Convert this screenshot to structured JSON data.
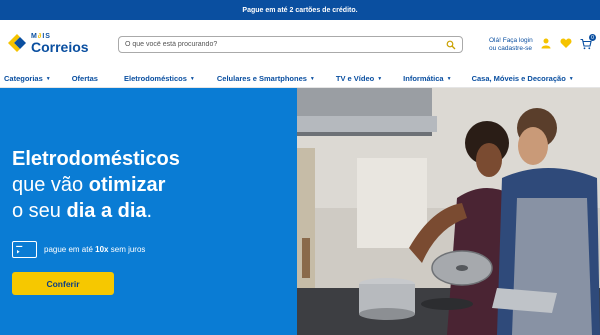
{
  "promo": {
    "text": "Pague em até 2 cartões de crédito."
  },
  "logo": {
    "mais_a": "M",
    "mais_b": "∂",
    "mais_c": "IS",
    "name": "Correios"
  },
  "search": {
    "placeholder": "O que você está procurando?"
  },
  "account": {
    "line1": "Olá! Faça login",
    "line2": "ou cadastre-se"
  },
  "cart": {
    "count": "0"
  },
  "nav": {
    "items": [
      {
        "label": "Categorias",
        "has_chevron": true
      },
      {
        "label": "Ofertas",
        "has_chevron": false
      },
      {
        "label": "Eletrodomésticos",
        "has_chevron": true
      },
      {
        "label": "Celulares e Smartphones",
        "has_chevron": true
      },
      {
        "label": "TV e Vídeo",
        "has_chevron": true
      },
      {
        "label": "Informática",
        "has_chevron": true
      },
      {
        "label": "Casa, Móveis e Decoração",
        "has_chevron": true
      }
    ]
  },
  "hero": {
    "line1": "Eletrodomésticos",
    "line2_pre": "que vão ",
    "line2_bold": "otimizar",
    "line3_pre": "o seu ",
    "line3_bold": "dia a dia",
    "line3_post": ".",
    "installment_pre": "pague em até ",
    "installment_bold": "10x",
    "installment_post": " sem juros",
    "cta_label": "Conferir"
  },
  "colors": {
    "brand_blue": "#0a4fa0",
    "hero_blue": "#0a7cd4",
    "accent_yellow": "#f6c800"
  }
}
